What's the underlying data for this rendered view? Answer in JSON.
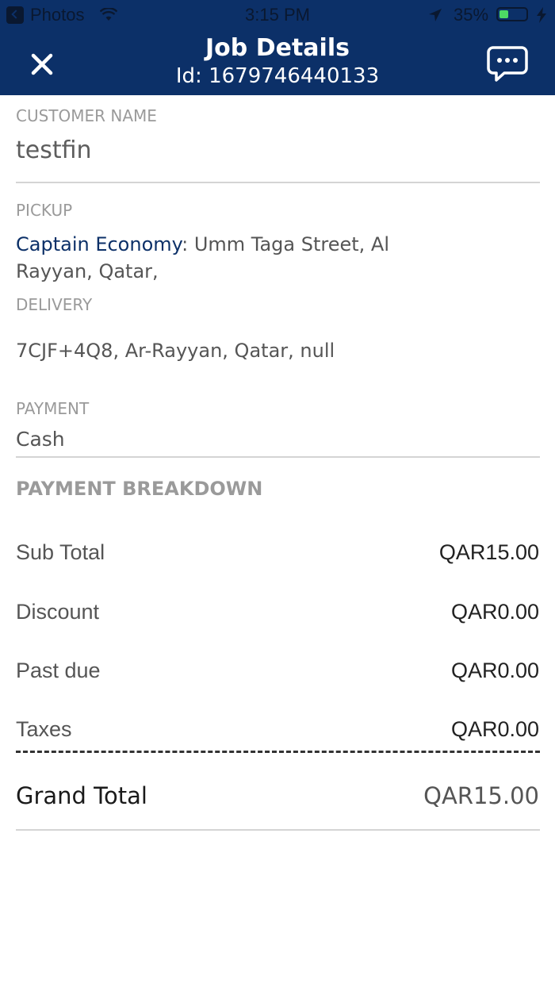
{
  "status_bar": {
    "app": "Photos",
    "time": "3:15 PM",
    "battery": "35%",
    "battery_level": 0.35
  },
  "header": {
    "title": "Job Details",
    "subtitle": "Id: 1679746440133",
    "close_icon": "close-icon",
    "chat_icon": "chat-bubble-icon",
    "background": "#0c3068"
  },
  "customer": {
    "label": "CUSTOMER NAME",
    "value": "testfin"
  },
  "pickup": {
    "label": "PICKUP",
    "name": "Captain Economy",
    "address": ": Umm Taga Street, Al Rayyan, Qatar,"
  },
  "delivery": {
    "label": "DELIVERY",
    "value": "7CJF+4Q8, Ar-Rayyan, Qatar, null"
  },
  "payment": {
    "label": "PAYMENT",
    "value": "Cash"
  },
  "breakdown": {
    "heading": "PAYMENT BREAKDOWN",
    "rows": [
      {
        "label": "Sub Total",
        "value": "QAR15.00"
      },
      {
        "label": "Discount",
        "value": "QAR0.00"
      },
      {
        "label": "Past due",
        "value": "QAR0.00"
      },
      {
        "label": "Taxes",
        "value": "QAR0.00"
      }
    ],
    "grand_label": "Grand Total",
    "grand_value": "QAR15.00"
  }
}
